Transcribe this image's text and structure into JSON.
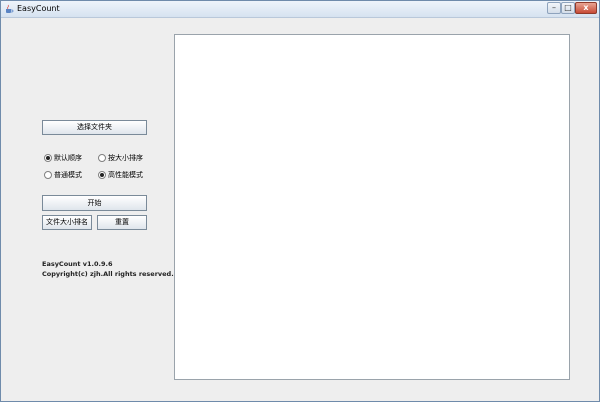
{
  "window": {
    "title": "EasyCount",
    "controls": {
      "minimize": "–",
      "maximize": "□",
      "close": "x"
    },
    "icon": "java-cup-icon"
  },
  "left_panel": {
    "select_folder_label": "选择文件夹",
    "sort_options": [
      {
        "label": "默认顺序",
        "checked": true
      },
      {
        "label": "按大小排序",
        "checked": false
      }
    ],
    "mode_options": [
      {
        "label": "普通模式",
        "checked": false
      },
      {
        "label": "高性能模式",
        "checked": true
      }
    ],
    "start_label": "开始",
    "size_rank_label": "文件大小排名",
    "reset_label": "重置",
    "version_text": "EasyCount v1.0.9.6",
    "copyright_text": "Copyright(c) zjh.All rights reserved."
  },
  "results_area": {
    "content": ""
  },
  "colors": {
    "window_bg": "#eeeeee",
    "results_bg": "#ffffff",
    "close_button": "#c74a36"
  }
}
